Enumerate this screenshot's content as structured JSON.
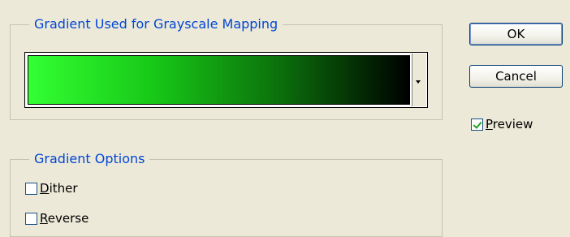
{
  "gradient_group": {
    "title": "Gradient Used for Grayscale Mapping",
    "gradient_colors": [
      "#33ff33",
      "#17c717",
      "#0b6e0b",
      "#000000"
    ]
  },
  "options_group": {
    "title": "Gradient Options",
    "dither": {
      "mnemonic": "D",
      "rest": "ither",
      "checked": false
    },
    "reverse": {
      "mnemonic": "R",
      "rest": "everse",
      "checked": false
    }
  },
  "buttons": {
    "ok": "OK",
    "cancel": "Cancel"
  },
  "preview": {
    "mnemonic": "P",
    "rest": "review",
    "checked": true
  }
}
